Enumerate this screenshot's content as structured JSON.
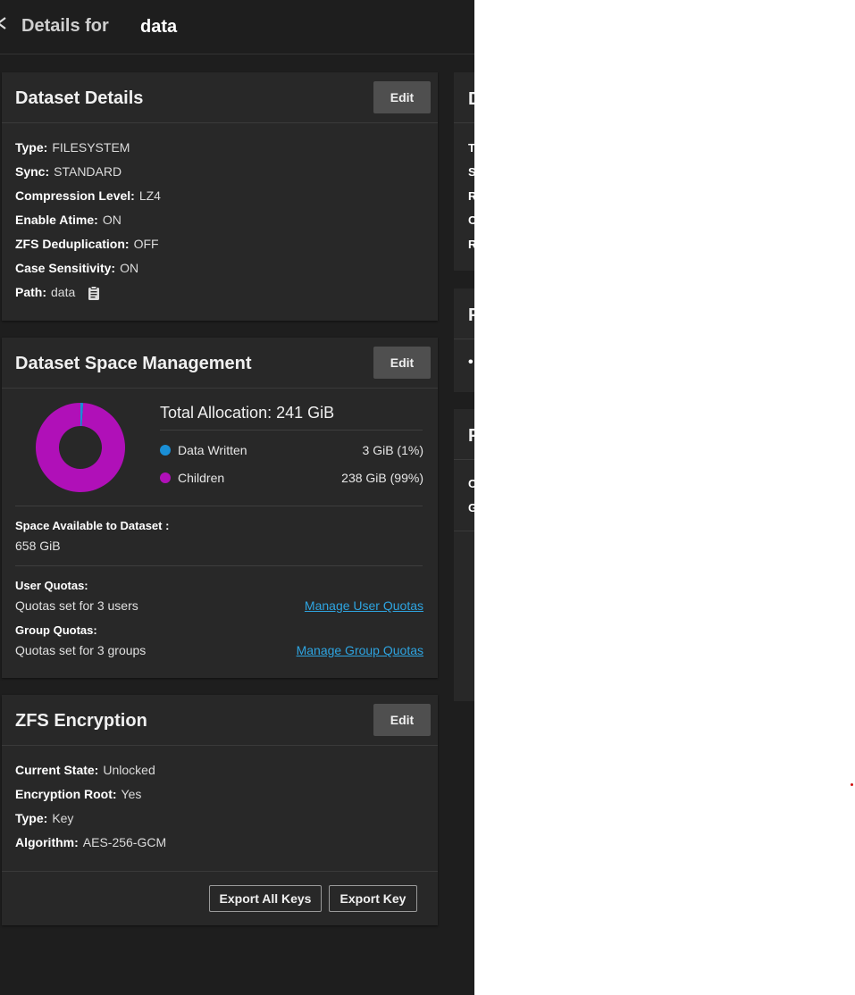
{
  "header": {
    "title": "Details for",
    "dataset_name": "data"
  },
  "dataset_details": {
    "title": "Dataset Details",
    "edit_label": "Edit",
    "rows": [
      {
        "label": "Type:",
        "value": "FILESYSTEM"
      },
      {
        "label": "Sync:",
        "value": "STANDARD"
      },
      {
        "label": "Compression Level:",
        "value": "LZ4"
      },
      {
        "label": "Enable Atime:",
        "value": "ON"
      },
      {
        "label": "ZFS Deduplication:",
        "value": "OFF"
      },
      {
        "label": "Case Sensitivity:",
        "value": "ON"
      },
      {
        "label": "Path:",
        "value": "data"
      }
    ],
    "path_icon": "clipboard-icon"
  },
  "space_management": {
    "title": "Dataset Space Management",
    "edit_label": "Edit",
    "total_allocation_label": "Total Allocation:",
    "total_allocation_value": "241 GiB",
    "legend": [
      {
        "label": "Data Written",
        "value": "3 GiB (1%)",
        "color": "#1a8fd6",
        "fraction": 0.01
      },
      {
        "label": "Children",
        "value": "238 GiB (99%)",
        "color": "#b010b8",
        "fraction": 0.99
      }
    ],
    "available_label": "Space Available to Dataset :",
    "available_value": "658 GiB",
    "user_quotas_label": "User Quotas:",
    "user_quotas_value": "Quotas set for 3 users",
    "user_quotas_link": "Manage User Quotas",
    "group_quotas_label": "Group Quotas:",
    "group_quotas_value": "Quotas set for 3 groups",
    "group_quotas_link": "Manage Group Quotas"
  },
  "encryption": {
    "title": "ZFS Encryption",
    "edit_label": "Edit",
    "rows": [
      {
        "label": "Current State:",
        "value": "Unlocked"
      },
      {
        "label": "Encryption Root:",
        "value": "Yes"
      },
      {
        "label": "Type:",
        "value": "Key"
      },
      {
        "label": "Algorithm:",
        "value": "AES-256-GCM"
      }
    ],
    "export_all_label": "Export All Keys",
    "export_key_label": "Export Key"
  },
  "right_column": {
    "card1_title": "D",
    "card1_rows": [
      "T",
      "S",
      "R",
      "C",
      "R"
    ],
    "card2_title": "P",
    "card2_bullet": "•",
    "card3_title": "P",
    "card3_rows": [
      "C",
      "G"
    ]
  },
  "colors": {
    "background": "#1e1e1e",
    "card": "#282828",
    "accent_blue": "#1a8fd6",
    "accent_magenta": "#b010b8",
    "link": "#2ea4e0"
  }
}
